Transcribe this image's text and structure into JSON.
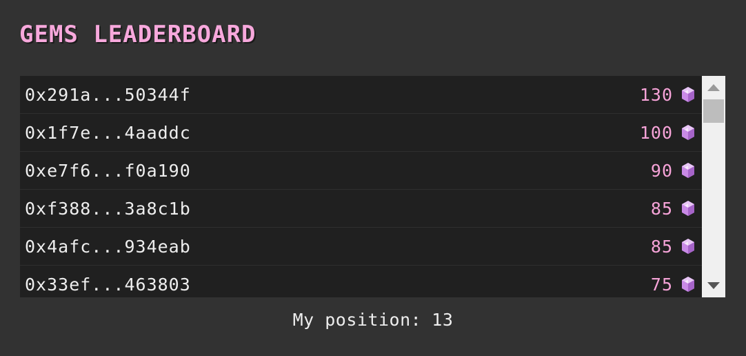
{
  "title": "GEMS LEADERBOARD",
  "rows": [
    {
      "address": "0x291a...50344f",
      "score": "130"
    },
    {
      "address": "0x1f7e...4aaddc",
      "score": "100"
    },
    {
      "address": "0xe7f6...f0a190",
      "score": "90"
    },
    {
      "address": "0xf388...3a8c1b",
      "score": "85"
    },
    {
      "address": "0x4afc...934eab",
      "score": "85"
    },
    {
      "address": "0x33ef...463803",
      "score": "75"
    }
  ],
  "footer": {
    "label": "My position:",
    "position": "13"
  },
  "colors": {
    "accent": "#f7a8dc",
    "gem": "#c98ae6",
    "background": "#323232"
  },
  "icons": {
    "gem": "gem-icon",
    "scroll_up": "scroll-up-arrow-icon",
    "scroll_down": "scroll-down-arrow-icon"
  }
}
